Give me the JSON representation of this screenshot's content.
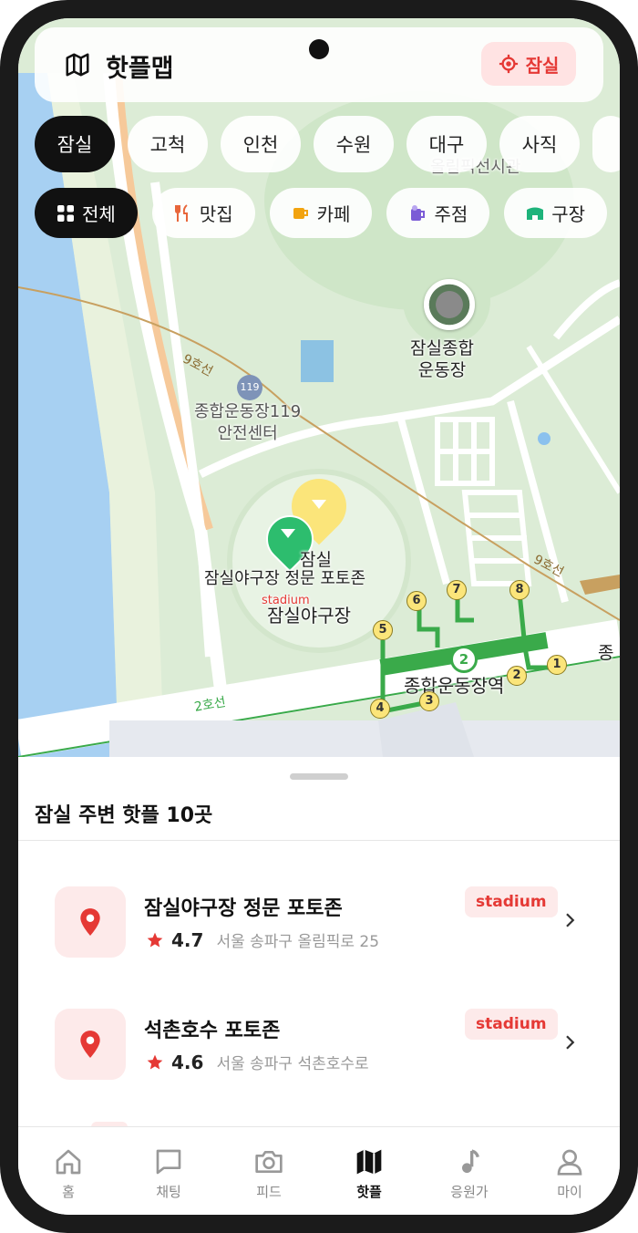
{
  "header": {
    "title": "핫플맵",
    "location_button": "잠실"
  },
  "regions": [
    "잠실",
    "고척",
    "인천",
    "수원",
    "대구",
    "사직"
  ],
  "active_region": "잠실",
  "filters": [
    {
      "label": "전체",
      "icon": "grid-icon"
    },
    {
      "label": "맛집",
      "icon": "utensils-icon"
    },
    {
      "label": "카페",
      "icon": "coffee-icon"
    },
    {
      "label": "주점",
      "icon": "beer-icon"
    },
    {
      "label": "구장",
      "icon": "stadium-icon"
    }
  ],
  "map": {
    "labels": {
      "olympic_stadium": "잠실종합\n운동장",
      "fire_center": "종합운동장119\n안전센터",
      "olympic_hall": "올림픽선시관",
      "marker_jamsil": "잠실",
      "marker_photozone": "잠실야구장 정문 포토존",
      "marker_category": "stadium",
      "baseball_stadium": "잠실야구장",
      "station": "종합운동장역",
      "station_cut": "종",
      "line9_a": "9호선",
      "line9_b": "9호선",
      "line2": "2호선",
      "line2_badge": "2",
      "exits": [
        "1",
        "2",
        "3",
        "4",
        "5",
        "6",
        "7",
        "8"
      ]
    }
  },
  "sheet": {
    "title": "잠실 주변 핫플 10곳",
    "places": [
      {
        "name": "잠실야구장 정문 포토존",
        "rating": "4.7",
        "address": "서울 송파구 올림픽로 25",
        "badge": "stadium"
      },
      {
        "name": "석촌호수 포토존",
        "rating": "4.6",
        "address": "서울 송파구 석촌호수로",
        "badge": "stadium"
      }
    ]
  },
  "nav": [
    {
      "label": "홈",
      "icon": "home-icon"
    },
    {
      "label": "채팅",
      "icon": "chat-icon"
    },
    {
      "label": "피드",
      "icon": "camera-icon"
    },
    {
      "label": "핫플",
      "icon": "map-icon"
    },
    {
      "label": "응원가",
      "icon": "music-note-icon"
    },
    {
      "label": "마이",
      "icon": "user-icon"
    }
  ],
  "active_nav": "핫플",
  "colors": {
    "accent": "#e53935",
    "map_green": "#dcecd6",
    "line2": "#3aaa4a",
    "line9": "#c8a060"
  }
}
